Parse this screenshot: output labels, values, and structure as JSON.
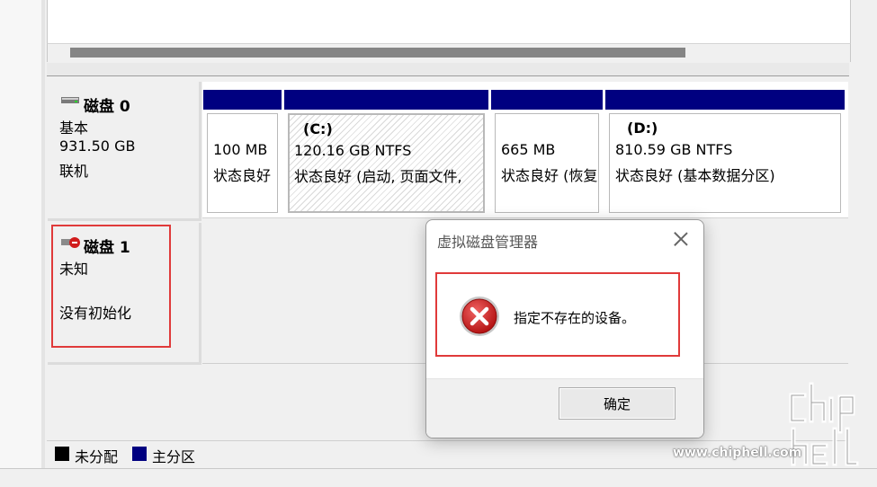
{
  "disks": [
    {
      "name": "磁盘 0",
      "type": "基本",
      "size": "931.50 GB",
      "status": "联机",
      "icon": "disk-icon",
      "partitions": [
        {
          "title": "",
          "line1": "100 MB",
          "line2": "状态良好"
        },
        {
          "title": "(C:)",
          "line1": "120.16 GB NTFS",
          "line2": "状态良好 (启动, 页面文件,"
        },
        {
          "title": "",
          "line1": "665 MB",
          "line2": "状态良好 (恢复"
        },
        {
          "title": "(D:)",
          "line1": "810.59 GB NTFS",
          "line2": "状态良好 (基本数据分区)"
        }
      ]
    },
    {
      "name": "磁盘 1",
      "type": "未知",
      "status": "没有初始化",
      "icon": "disk-error-icon"
    }
  ],
  "legend": {
    "unallocated": "未分配",
    "primary": "主分区",
    "colors": {
      "unallocated": "#000000",
      "primary": "#000080"
    }
  },
  "dialog": {
    "title": "虚拟磁盘管理器",
    "message": "指定不存在的设备。",
    "ok_label": "确定",
    "icon": "error-icon"
  },
  "watermark": {
    "url": "www.chiphell.com",
    "logo_text": "chip hell"
  },
  "colors": {
    "partition_bar": "#000080",
    "highlight": "#e03a3a"
  }
}
